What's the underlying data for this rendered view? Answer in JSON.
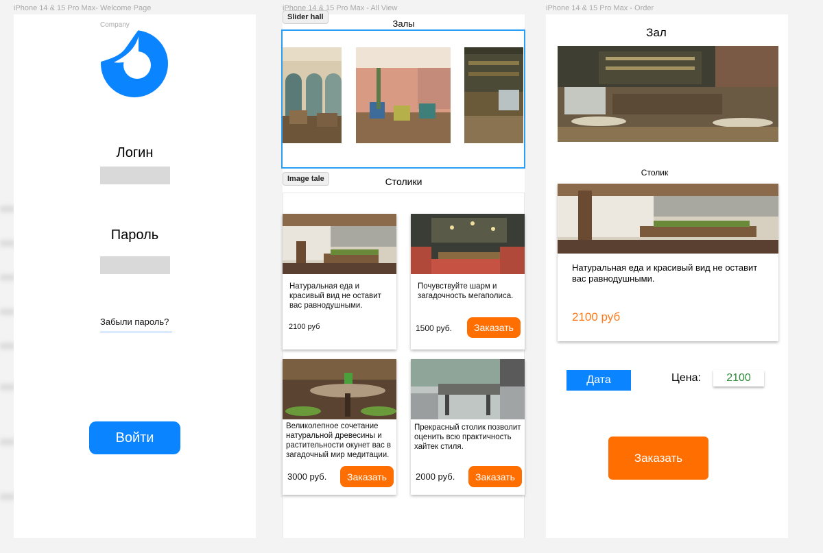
{
  "frames": {
    "welcome": {
      "title": "iPhone 14 & 15 Pro Max- Welcome Page",
      "company": "Company",
      "login_label": "Логин",
      "password_label": "Пароль",
      "forgot": "Забыли пароль?",
      "enter_button": "Войти"
    },
    "all_view": {
      "title": "iPhone 14 & 15 Pro Max - All View",
      "slider_tag": "Slider hall",
      "halls_title": "Залы",
      "image_tag": "Image tale",
      "tables_title": "Столики",
      "cards": [
        {
          "desc": "Натуральная еда и красивый вид не оставит вас равнодушными.",
          "price": "2100 руб",
          "order": ""
        },
        {
          "desc": "Почувствуйте шарм и загадочность мегаполиса.",
          "price": "1500 руб.",
          "order": "Заказать"
        },
        {
          "desc": "Великолепное сочетание натуральной древесины и растительности окунет вас в загадочный мир медитации.",
          "price": "3000 руб.",
          "order": "Заказать"
        },
        {
          "desc": "Прекрасный столик позволит оценить всю практичность хайтек стиля.",
          "price": "2000 руб.",
          "order": "Заказать"
        }
      ]
    },
    "order": {
      "title": "iPhone 14 & 15 Pro Max - Order",
      "hall_title": "Зал",
      "table_title": "Столик",
      "desc": "Натуральная еда и красивый вид не оставит вас равнодушными.",
      "price": "2100 руб",
      "date_button": "Дата",
      "price_label": "Цена:",
      "price_value": "2100",
      "order_button": "Заказать"
    }
  },
  "colors": {
    "accent_blue": "#0a84ff",
    "accent_orange": "#ff6e00",
    "price_green": "#2e8b3a"
  }
}
